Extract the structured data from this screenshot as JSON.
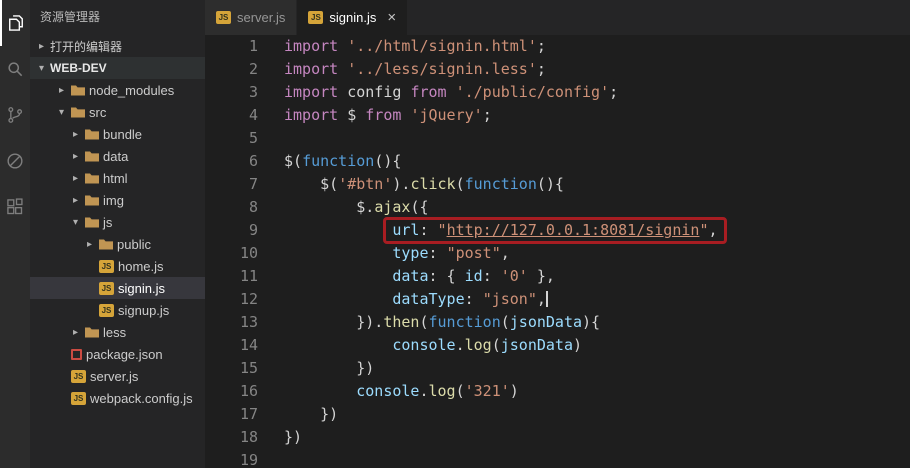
{
  "colors": {
    "bg-activity": "#2c2c2c",
    "bg-sidebar": "#252526",
    "bg-editor": "#1e1e1e",
    "bg-tabbar": "#252526",
    "bg-tab-inactive": "#2d2d2d",
    "bg-selected-row": "#37373d",
    "tk-kw": "#c586c0",
    "tk-str": "#ce9178",
    "tk-kb": "#569cd6",
    "tk-pr": "#9cdcfe",
    "tk-fn": "#dcdcaa",
    "tk-pl": "#d4d4d4",
    "line-number": "#858585",
    "annotation-red": "#a81d22",
    "folder-icon": "#c09553",
    "js-icon": "#d5a439",
    "npm-icon": "#cb4b42"
  },
  "activity_bar": {
    "icons": [
      "explorer-icon",
      "search-icon",
      "source-control-icon",
      "debug-icon",
      "extensions-icon"
    ]
  },
  "sidebar": {
    "title": "资源管理器",
    "open_editors_label": "打开的编辑器",
    "root_label": "WEB-DEV",
    "js_badge_text": "JS",
    "tree": [
      {
        "label": "node_modules",
        "icon": "folder",
        "chevron": "collapsed",
        "depth": 1
      },
      {
        "label": "src",
        "icon": "folder",
        "chevron": "expanded",
        "depth": 1
      },
      {
        "label": "bundle",
        "icon": "folder",
        "chevron": "collapsed",
        "depth": 2
      },
      {
        "label": "data",
        "icon": "folder",
        "chevron": "collapsed",
        "depth": 2
      },
      {
        "label": "html",
        "icon": "folder",
        "chevron": "collapsed",
        "depth": 2
      },
      {
        "label": "img",
        "icon": "folder",
        "chevron": "collapsed",
        "depth": 2
      },
      {
        "label": "js",
        "icon": "folder",
        "chevron": "expanded",
        "depth": 2
      },
      {
        "label": "public",
        "icon": "folder",
        "chevron": "collapsed",
        "depth": 3
      },
      {
        "label": "home.js",
        "icon": "js",
        "depth": 3
      },
      {
        "label": "signin.js",
        "icon": "js",
        "depth": 3,
        "selected": true
      },
      {
        "label": "signup.js",
        "icon": "js",
        "depth": 3
      },
      {
        "label": "less",
        "icon": "folder",
        "chevron": "collapsed",
        "depth": 2
      },
      {
        "label": "package.json",
        "icon": "npm",
        "depth": 1
      },
      {
        "label": "server.js",
        "icon": "js",
        "depth": 1
      },
      {
        "label": "webpack.config.js",
        "icon": "js",
        "depth": 1
      }
    ]
  },
  "editor": {
    "tabs": [
      {
        "label": "server.js",
        "active": false
      },
      {
        "label": "signin.js",
        "active": true,
        "close": "×"
      }
    ],
    "lines": [
      {
        "n": 1,
        "tokens": [
          [
            "kw",
            "import"
          ],
          [
            "pl",
            " "
          ],
          [
            "str",
            "'../html/signin.html'"
          ],
          [
            "pl",
            ";"
          ]
        ]
      },
      {
        "n": 2,
        "tokens": [
          [
            "kw",
            "import"
          ],
          [
            "pl",
            " "
          ],
          [
            "str",
            "'../less/signin.less'"
          ],
          [
            "pl",
            ";"
          ]
        ]
      },
      {
        "n": 3,
        "tokens": [
          [
            "kw",
            "import"
          ],
          [
            "pl",
            " config "
          ],
          [
            "kw",
            "from"
          ],
          [
            "pl",
            " "
          ],
          [
            "str",
            "'./public/config'"
          ],
          [
            "pl",
            ";"
          ]
        ]
      },
      {
        "n": 4,
        "tokens": [
          [
            "kw",
            "import"
          ],
          [
            "pl",
            " $ "
          ],
          [
            "kw",
            "from"
          ],
          [
            "pl",
            " "
          ],
          [
            "str",
            "'jQuery'"
          ],
          [
            "pl",
            ";"
          ]
        ]
      },
      {
        "n": 5,
        "tokens": []
      },
      {
        "n": 6,
        "tokens": [
          [
            "pl",
            "$("
          ],
          [
            "kb",
            "function"
          ],
          [
            "pl",
            "(){"
          ]
        ]
      },
      {
        "n": 7,
        "tokens": [
          [
            "pl",
            "    $("
          ],
          [
            "str",
            "'#btn'"
          ],
          [
            "pl",
            ")."
          ],
          [
            "fn",
            "click"
          ],
          [
            "pl",
            "("
          ],
          [
            "kb",
            "function"
          ],
          [
            "pl",
            "(){"
          ]
        ]
      },
      {
        "n": 8,
        "tokens": [
          [
            "pl",
            "        $."
          ],
          [
            "fn",
            "ajax"
          ],
          [
            "pl",
            "({"
          ]
        ]
      },
      {
        "n": 9,
        "annotate_from": 1,
        "tokens": [
          [
            "pl",
            "            "
          ],
          [
            "pr",
            "url"
          ],
          [
            "pl",
            ": "
          ],
          [
            "str",
            "\""
          ],
          [
            "lnk",
            "http://127.0.0.1:8081/signin"
          ],
          [
            "str",
            "\""
          ],
          [
            "pl",
            ","
          ]
        ]
      },
      {
        "n": 10,
        "tokens": [
          [
            "pl",
            "            "
          ],
          [
            "pr",
            "type"
          ],
          [
            "pl",
            ": "
          ],
          [
            "str",
            "\"post\""
          ],
          [
            "pl",
            ","
          ]
        ]
      },
      {
        "n": 11,
        "tokens": [
          [
            "pl",
            "            "
          ],
          [
            "pr",
            "data"
          ],
          [
            "pl",
            ": { "
          ],
          [
            "pr",
            "id"
          ],
          [
            "pl",
            ": "
          ],
          [
            "str",
            "'0'"
          ],
          [
            "pl",
            " },"
          ]
        ]
      },
      {
        "n": 12,
        "cursor": true,
        "tokens": [
          [
            "pl",
            "            "
          ],
          [
            "pr",
            "dataType"
          ],
          [
            "pl",
            ": "
          ],
          [
            "str",
            "\"json\""
          ],
          [
            "pl",
            ","
          ]
        ]
      },
      {
        "n": 13,
        "tokens": [
          [
            "pl",
            "        })."
          ],
          [
            "fn",
            "then"
          ],
          [
            "pl",
            "("
          ],
          [
            "kb",
            "function"
          ],
          [
            "pl",
            "("
          ],
          [
            "pr",
            "jsonData"
          ],
          [
            "pl",
            "){"
          ]
        ]
      },
      {
        "n": 14,
        "tokens": [
          [
            "pl",
            "            "
          ],
          [
            "pr",
            "console"
          ],
          [
            "pl",
            "."
          ],
          [
            "fn",
            "log"
          ],
          [
            "pl",
            "("
          ],
          [
            "pr",
            "jsonData"
          ],
          [
            "pl",
            ")"
          ]
        ]
      },
      {
        "n": 15,
        "tokens": [
          [
            "pl",
            "        })"
          ]
        ]
      },
      {
        "n": 16,
        "tokens": [
          [
            "pl",
            "        "
          ],
          [
            "pr",
            "console"
          ],
          [
            "pl",
            "."
          ],
          [
            "fn",
            "log"
          ],
          [
            "pl",
            "("
          ],
          [
            "str",
            "'321'"
          ],
          [
            "pl",
            ")"
          ]
        ]
      },
      {
        "n": 17,
        "tokens": [
          [
            "pl",
            "    })"
          ]
        ]
      },
      {
        "n": 18,
        "tokens": [
          [
            "pl",
            "})"
          ]
        ]
      },
      {
        "n": 19,
        "tokens": []
      }
    ]
  }
}
